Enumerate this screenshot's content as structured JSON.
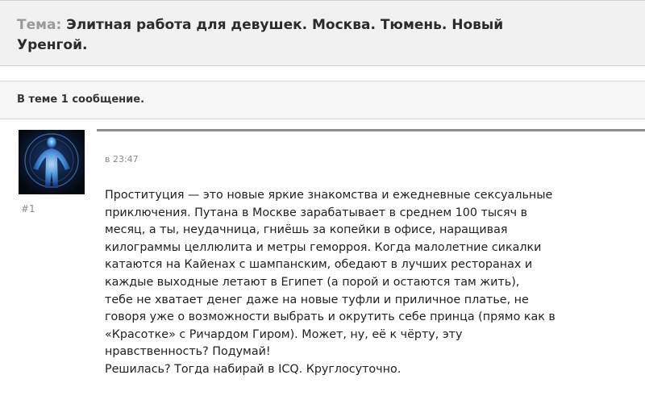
{
  "topic": {
    "prefix": "Тема:",
    "title": "Элитная работа для девушек. Москва. Тюмень. Новый Уренгой."
  },
  "thread": {
    "count_text": "В теме 1 сообщение."
  },
  "post": {
    "number": "#1",
    "time": "в 23:47",
    "avatar_icon": "glowing-figure-avatar",
    "body": "Проституция — это новые яркие знакомства и ежедневные сексуальные\nприключения. Путана в Москве зарабатывает в среднем 100 тысяч в\nмесяц, а ты, неудачница, гниёшь за копейки в офисе, наращивая\nкилограммы целлюлита и метры геморроя. Когда малолетние сикалки\nкатаются на Кайенах с шампанским, обедают в лучших ресторанах и\nкаждые выходные летают в Египет (а порой и остаются там жить),\nтебе не хватает денег даже на новые туфли и приличное платье, не\nговоря уже о возможности выбрать и окрутить себе принца (прямо как в\n«Красотке» с Ричардом Гиром). Может, ну, её к чёрту, эту\nнравственность? Подумай!\nРешилась? Тогда набирай в ICQ. Круглосуточно."
  }
}
